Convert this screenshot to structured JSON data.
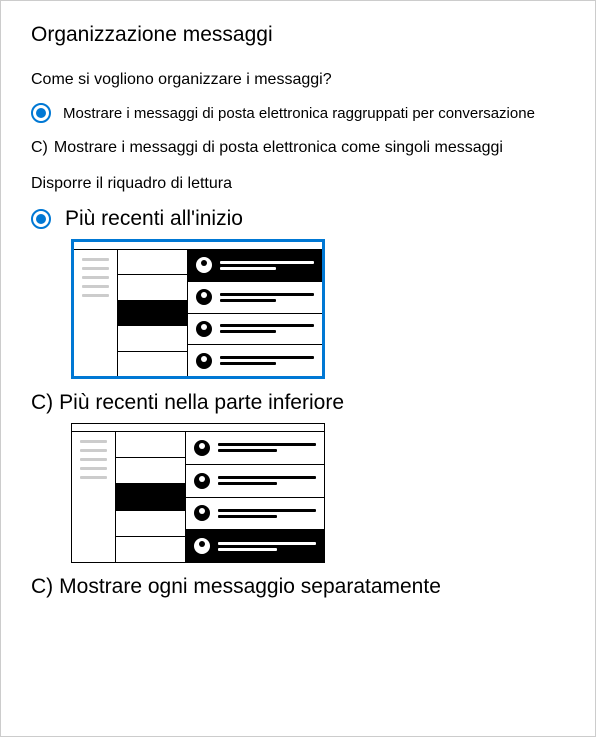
{
  "title": "Organizzazione messaggi",
  "q1": {
    "question": "Come si vogliono organizzare i messaggi?",
    "opt1": "Mostrare i messaggi di posta elettronica raggruppati per conversazione",
    "opt2_prefix": "C)",
    "opt2": "Mostrare i messaggi di posta elettronica come singoli messaggi"
  },
  "q2": {
    "heading": "Disporre il riquadro di lettura",
    "opt1": "Più recenti all'inizio",
    "opt2_prefix": "C)",
    "opt2": "Più recenti nella parte inferiore",
    "opt3_prefix": "C)",
    "opt3": "Mostrare ogni messaggio separatamente"
  }
}
